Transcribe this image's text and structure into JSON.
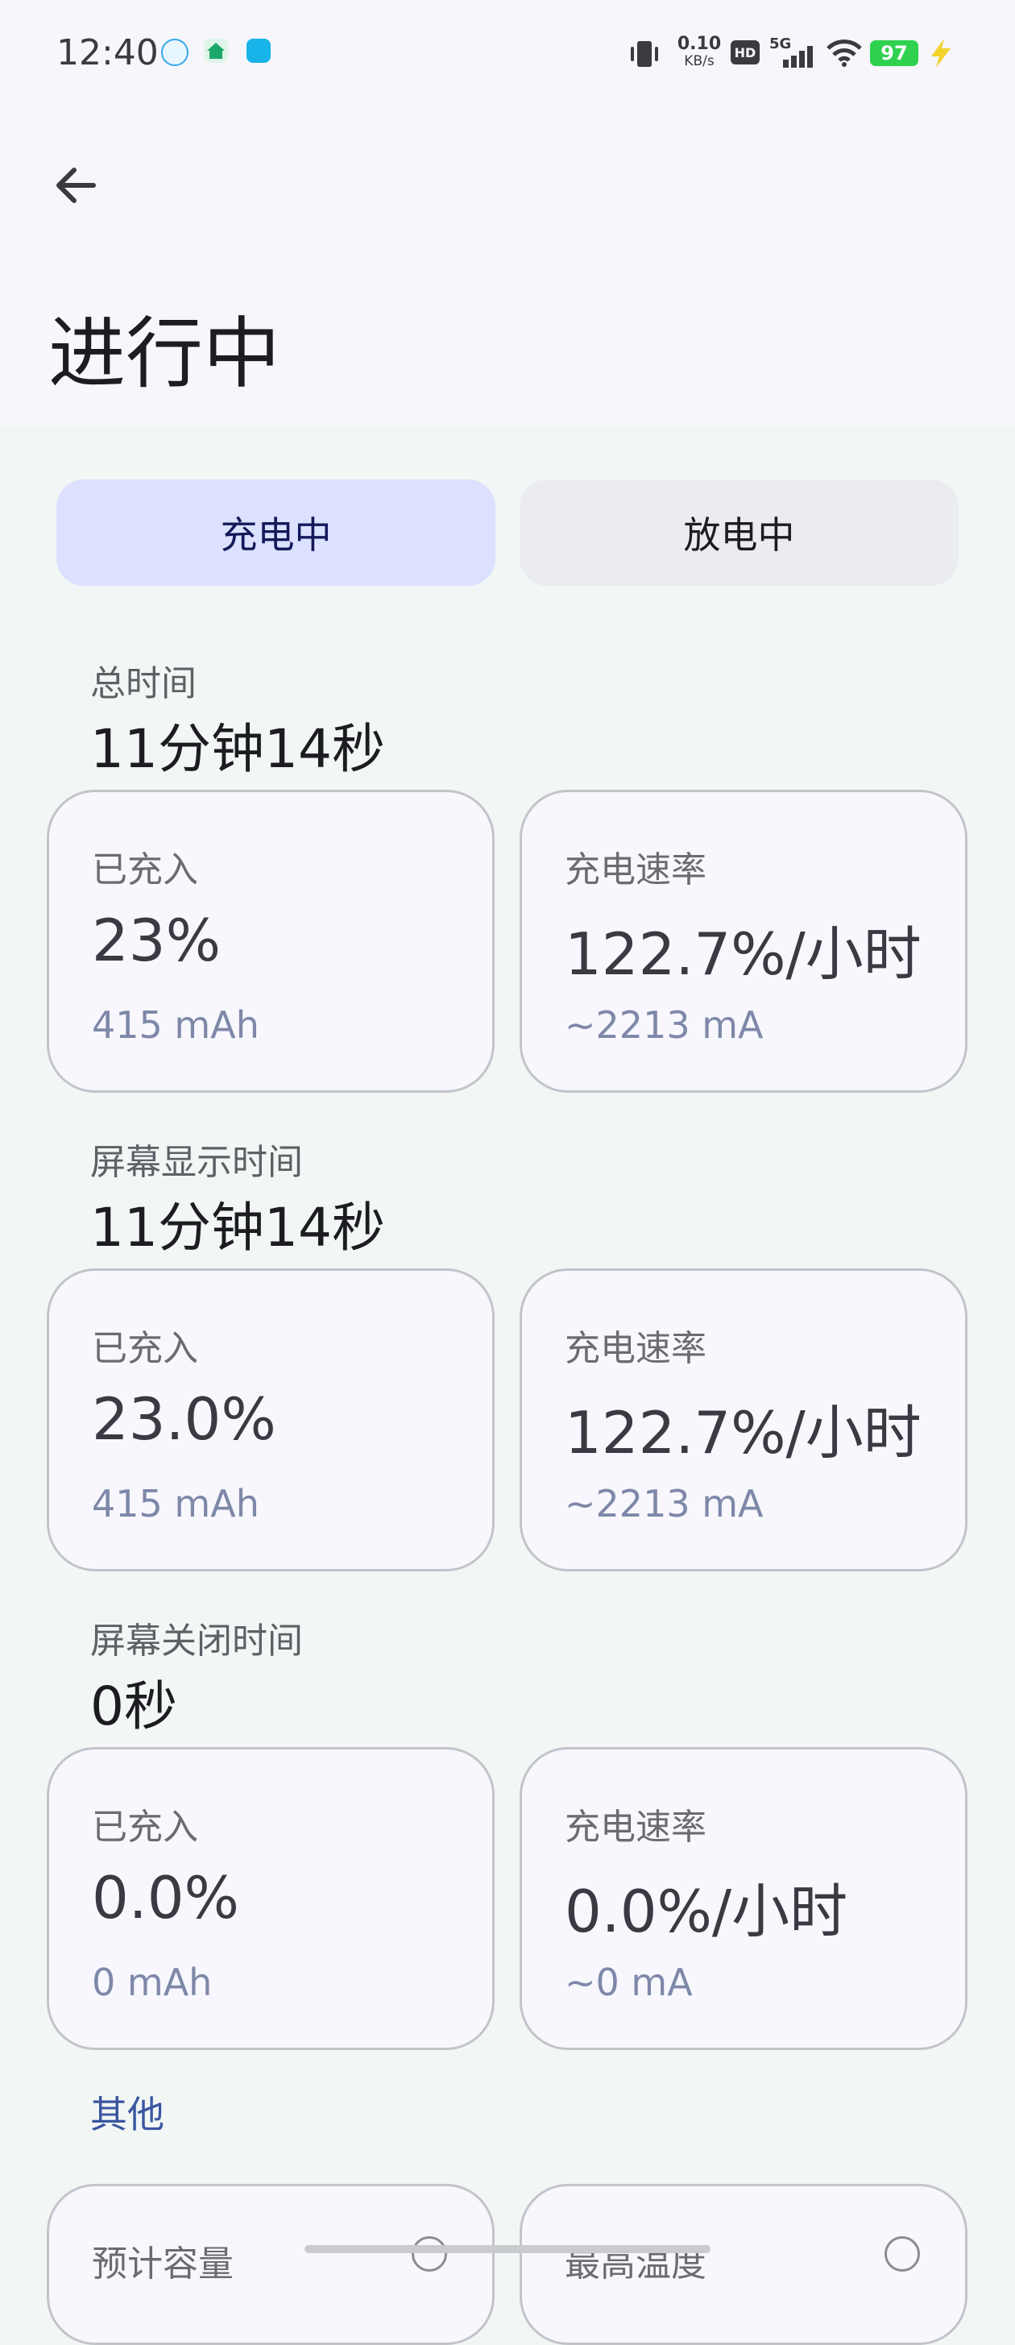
{
  "status_bar": {
    "time": "12:40",
    "net_speed_value": "0.10",
    "net_speed_unit": "KB/s",
    "hd": "HD",
    "signal": "5G",
    "battery": "97"
  },
  "app_bar": {
    "title": "进行中"
  },
  "segment": {
    "charging": "充电中",
    "discharging": "放电中"
  },
  "sections": [
    {
      "label": "总时间",
      "value": "11分钟14秒",
      "cards": [
        {
          "label": "已充入",
          "value": "23%",
          "sub": "415 mAh"
        },
        {
          "label": "充电速率",
          "value": "122.7%/小时",
          "sub": "~2213 mA"
        }
      ]
    },
    {
      "label": "屏幕显示时间",
      "value": "11分钟14秒",
      "cards": [
        {
          "label": "已充入",
          "value": "23.0%",
          "sub": "415 mAh"
        },
        {
          "label": "充电速率",
          "value": "122.7%/小时",
          "sub": "~2213 mA"
        }
      ]
    },
    {
      "label": "屏幕关闭时间",
      "value": "0秒",
      "cards": [
        {
          "label": "已充入",
          "value": "0.0%",
          "sub": "0 mAh"
        },
        {
          "label": "充电速率",
          "value": "0.0%/小时",
          "sub": "~0 mA"
        }
      ]
    }
  ],
  "other": {
    "label": "其他",
    "cards": [
      {
        "label": "预计容量"
      },
      {
        "label": "最高温度"
      }
    ]
  },
  "colors": {
    "accent_segment": "#dbe1ff",
    "battery_green": "#2fd14e",
    "charging_bolt": "#f4d22b",
    "link_blue": "#3a56a0"
  }
}
